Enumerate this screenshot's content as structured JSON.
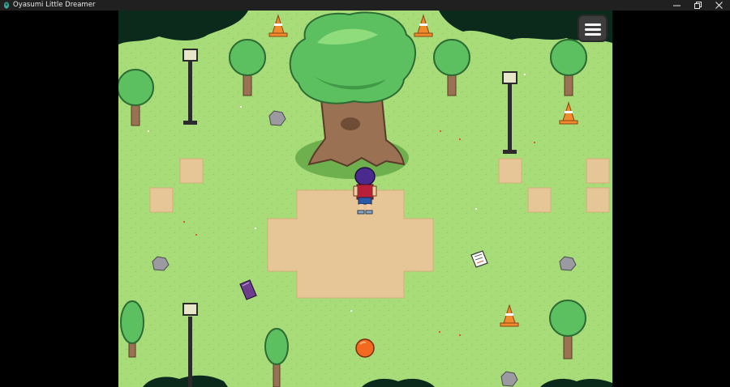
{
  "window": {
    "title": "Oyasumi Little Dreamer",
    "minimize_icon": "minimize-icon",
    "restore_icon": "restore-icon",
    "close_icon": "close-icon"
  },
  "game": {
    "menu_icon": "hamburger-menu-icon",
    "colors": {
      "grass": "#a7dc79",
      "dirt": "#e6c596",
      "tree_leaves": "#5cc060",
      "trunk": "#9a7152",
      "cone": "#f08a2c",
      "ball": "#f26a1f",
      "book": "#6c3e8c"
    }
  }
}
